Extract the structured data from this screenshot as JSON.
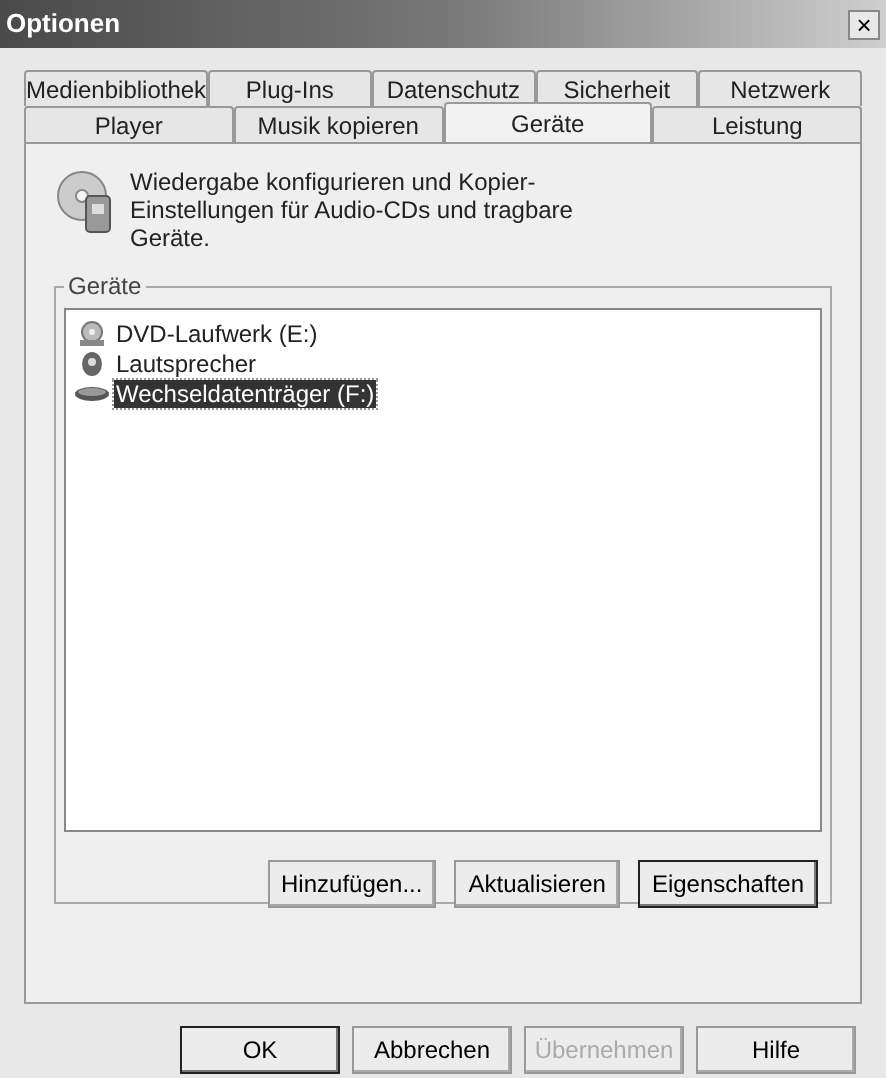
{
  "window": {
    "title": "Optionen",
    "close": "×"
  },
  "tab_rows": [
    [
      {
        "label": "Medienbibliothek",
        "selected": false
      },
      {
        "label": "Plug-Ins",
        "selected": false
      },
      {
        "label": "Datenschutz",
        "selected": false
      },
      {
        "label": "Sicherheit",
        "selected": false
      },
      {
        "label": "Netzwerk",
        "selected": false
      }
    ],
    [
      {
        "label": "Player",
        "selected": false
      },
      {
        "label": "Musik kopieren",
        "selected": false
      },
      {
        "label": "Geräte",
        "selected": true
      },
      {
        "label": "Leistung",
        "selected": false
      }
    ]
  ],
  "description": "Wiedergabe konfigurieren und Kopier-Einstellungen für Audio-CDs und tragbare Geräte.",
  "devices_group": {
    "title": "Geräte",
    "items": [
      {
        "label": "DVD-Laufwerk (E:)",
        "kind": "dvd",
        "selected": false
      },
      {
        "label": "Lautsprecher",
        "kind": "speaker",
        "selected": false
      },
      {
        "label": "Wechseldatenträger (F:)",
        "kind": "drive",
        "selected": true
      }
    ],
    "buttons": [
      {
        "label": "Hinzufügen...",
        "disabled": false,
        "default": false
      },
      {
        "label": "Aktualisieren",
        "disabled": false,
        "default": false
      },
      {
        "label": "Eigenschaften",
        "disabled": false,
        "default": true
      }
    ]
  },
  "buttons": [
    {
      "label": "OK",
      "disabled": false,
      "default": true
    },
    {
      "label": "Abbrechen",
      "disabled": false,
      "default": false
    },
    {
      "label": "Übernehmen",
      "disabled": true,
      "default": false
    },
    {
      "label": "Hilfe",
      "disabled": false,
      "default": false
    }
  ]
}
